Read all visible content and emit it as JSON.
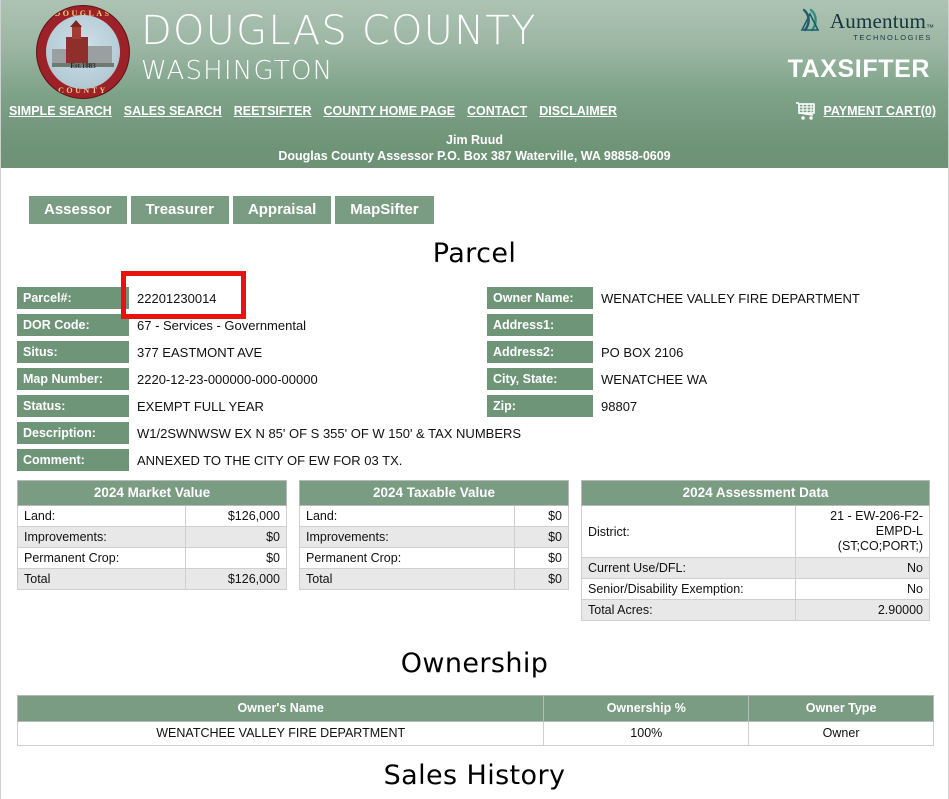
{
  "header": {
    "logo_alt": "Douglas County seal",
    "seal_top": "DOUGLAS",
    "seal_bottom": "COUNTY",
    "seal_est": "Est.1883",
    "title_main": "DOUGLAS COUNTY",
    "title_sub": "WASHINGTON",
    "brand_name": "Aumentum",
    "brand_sup": "™",
    "brand_tagline": "TECHNOLOGIES",
    "product": "TAXSIFTER",
    "nav": [
      "SIMPLE SEARCH",
      "SALES SEARCH",
      "REETSIFTER",
      "COUNTY HOME PAGE",
      "CONTACT",
      "DISCLAIMER"
    ],
    "cart_label": "PAYMENT CART(0)",
    "assessor_name": "Jim Ruud",
    "assessor_address": "Douglas County Assessor P.O. Box 387 Waterville, WA 98858-0609"
  },
  "tabs": [
    {
      "label": "Assessor"
    },
    {
      "label": "Treasurer"
    },
    {
      "label": "Appraisal"
    },
    {
      "label": "MapSifter"
    }
  ],
  "sections": {
    "parcel_title": "Parcel",
    "ownership_title": "Ownership",
    "sales_title": "Sales History"
  },
  "parcel": {
    "left": [
      {
        "label": "Parcel#:",
        "value": "22201230014"
      },
      {
        "label": "DOR Code:",
        "value": "67 - Services - Governmental"
      },
      {
        "label": "Situs:",
        "value": "377 EASTMONT AVE"
      },
      {
        "label": "Map Number:",
        "value": "2220-12-23-000000-000-00000"
      },
      {
        "label": "Status:",
        "value": "EXEMPT FULL YEAR"
      },
      {
        "label": "Description:",
        "value": "W1/2SWNWSW EX N 85' OF S 355' OF W 150' & TAX NUMBERS"
      },
      {
        "label": "Comment:",
        "value": "ANNEXED TO THE CITY OF EW FOR 03 TX."
      }
    ],
    "right": [
      {
        "label": "Owner Name:",
        "value": "WENATCHEE VALLEY FIRE DEPARTMENT"
      },
      {
        "label": "Address1:",
        "value": ""
      },
      {
        "label": "Address2:",
        "value": "PO BOX 2106"
      },
      {
        "label": "City, State:",
        "value": "WENATCHEE WA"
      },
      {
        "label": "Zip:",
        "value": "98807"
      }
    ]
  },
  "market_value": {
    "title": "2024 Market Value",
    "rows": [
      {
        "label": "Land:",
        "value": "$126,000"
      },
      {
        "label": "Improvements:",
        "value": "$0"
      },
      {
        "label": "Permanent Crop:",
        "value": "$0"
      },
      {
        "label": "Total",
        "value": "$126,000"
      }
    ]
  },
  "taxable_value": {
    "title": "2024 Taxable Value",
    "rows": [
      {
        "label": "Land:",
        "value": "$0"
      },
      {
        "label": "Improvements:",
        "value": "$0"
      },
      {
        "label": "Permanent Crop:",
        "value": "$0"
      },
      {
        "label": "Total",
        "value": "$0"
      }
    ]
  },
  "assessment": {
    "title": "2024 Assessment Data",
    "rows": [
      {
        "label": "District:",
        "value": "21 - EW-206-F2-\nEMPD-L\n(ST;CO;PORT;)"
      },
      {
        "label": "Current Use/DFL:",
        "value": "No"
      },
      {
        "label": "Senior/Disability Exemption:",
        "value": "No"
      },
      {
        "label": "Total Acres:",
        "value": "2.90000"
      }
    ]
  },
  "ownership": {
    "columns": [
      "Owner's Name",
      "Ownership %",
      "Owner Type"
    ],
    "rows": [
      {
        "name": "WENATCHEE VALLEY FIRE DEPARTMENT",
        "percent": "100%",
        "type": "Owner"
      }
    ]
  },
  "colors": {
    "green_label": "#6f9579",
    "green_header": "#7a9c82",
    "highlight_red": "#e8130f",
    "alt_row": "#e8e8e8"
  }
}
